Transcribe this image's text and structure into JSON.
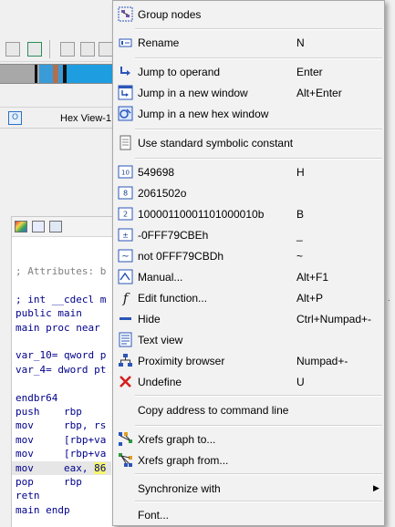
{
  "background": {
    "tab": {
      "label": "Hex View-1"
    },
    "code_lines": [
      {
        "text": "; Attributes: b",
        "kind": "comment"
      },
      {
        "text": "",
        "kind": "gap"
      },
      {
        "text": "; int __cdecl m",
        "kind": "normal"
      },
      {
        "text": "public main",
        "kind": "normal"
      },
      {
        "text": "main proc near",
        "kind": "normal"
      },
      {
        "text": "",
        "kind": "gap"
      },
      {
        "text": "var_10= qword p",
        "kind": "normal"
      },
      {
        "text": "var_4= dword pt",
        "kind": "normal"
      },
      {
        "text": "",
        "kind": "gap"
      },
      {
        "text": "endbr64",
        "kind": "normal"
      },
      {
        "text": "push    rbp",
        "kind": "normal"
      },
      {
        "text": "mov     rbp, rs",
        "kind": "normal"
      },
      {
        "text": "mov     [rbp+va",
        "kind": "normal"
      },
      {
        "text": "mov     [rbp+va",
        "kind": "normal"
      },
      {
        "text": "mov     eax, ",
        "highlight": "86",
        "kind": "selected"
      },
      {
        "text": "pop     rbp",
        "kind": "normal"
      },
      {
        "text": "retn",
        "kind": "normal"
      },
      {
        "text": "main endp",
        "kind": "normal"
      }
    ]
  },
  "menu": {
    "items": [
      {
        "id": "group-nodes",
        "icon": "group-nodes-icon",
        "label": "Group nodes",
        "key": ""
      },
      {
        "id": "rename",
        "icon": "rename-icon",
        "label": "Rename",
        "key": "N"
      },
      {
        "id": "jump-operand",
        "icon": "jump-arrow-icon",
        "label": "Jump to operand",
        "key": "Enter"
      },
      {
        "id": "jump-new-window",
        "icon": "new-window-icon",
        "label": "Jump in a new window",
        "key": "Alt+Enter"
      },
      {
        "id": "jump-hex-window",
        "icon": "hex-window-icon",
        "label": "Jump in a new hex window",
        "key": ""
      },
      {
        "id": "symbolic-constant",
        "icon": "document-icon",
        "label": "Use standard symbolic constant",
        "key": ""
      },
      {
        "id": "decimal",
        "icon": "decimal-icon",
        "label": "549698",
        "key": "H"
      },
      {
        "id": "octal",
        "icon": "octal-icon",
        "label": "2061502o",
        "key": ""
      },
      {
        "id": "binary",
        "icon": "binary-icon",
        "label": "10000110001101000010b",
        "key": "B"
      },
      {
        "id": "negate",
        "icon": "negate-icon",
        "label": "-0FFF79CBEh",
        "key": "_"
      },
      {
        "id": "bitwise-not",
        "icon": "bitwise-not-icon",
        "label": "not 0FFF79CBDh",
        "key": "~"
      },
      {
        "id": "manual",
        "icon": "manual-icon",
        "label": "Manual...",
        "key": "Alt+F1"
      },
      {
        "id": "edit-function",
        "icon": "function-icon",
        "label": "Edit function...",
        "key": "Alt+P"
      },
      {
        "id": "hide",
        "icon": "hide-icon",
        "label": "Hide",
        "key": "Ctrl+Numpad+-"
      },
      {
        "id": "text-view",
        "icon": "text-view-icon",
        "label": "Text view",
        "key": ""
      },
      {
        "id": "proximity-browser",
        "icon": "proximity-icon",
        "label": "Proximity browser",
        "key": "Numpad+-"
      },
      {
        "id": "undefine",
        "icon": "undefine-icon",
        "label": "Undefine",
        "key": "U"
      },
      {
        "id": "copy-address",
        "icon": "",
        "label": "Copy address to command line",
        "key": ""
      },
      {
        "id": "xrefs-to",
        "icon": "xrefs-to-icon",
        "label": "Xrefs graph to...",
        "key": ""
      },
      {
        "id": "xrefs-from",
        "icon": "xrefs-from-icon",
        "label": "Xrefs graph from...",
        "key": ""
      },
      {
        "id": "synchronize",
        "icon": "",
        "label": "Synchronize with",
        "key": "",
        "submenu": true
      },
      {
        "id": "font",
        "icon": "",
        "label": "Font...",
        "key": ""
      }
    ]
  }
}
